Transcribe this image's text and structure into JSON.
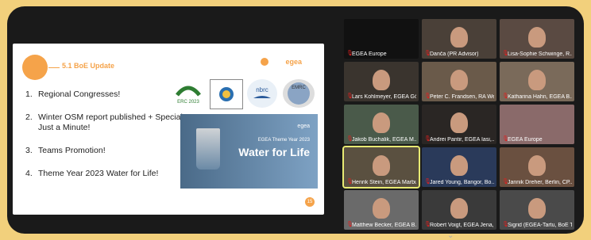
{
  "slide": {
    "title": "5.1 BoE Update",
    "brand": "egea",
    "items": [
      {
        "num": "1.",
        "text": "Regional Congresses!"
      },
      {
        "num": "2.",
        "text": "Winter OSM report published + Special Just a Minute!"
      },
      {
        "num": "3.",
        "text": "Teams Promotion!"
      },
      {
        "num": "4.",
        "text": "Theme Year 2023 Water for Life!"
      }
    ],
    "logos": [
      "ERC 2023",
      "WESTERN REGIONAL CONGRESS 2023",
      "nbrc",
      "EMRC"
    ],
    "banner": {
      "brand": "egea",
      "subtitle": "EGEA Theme Year 2023",
      "title": "Water for Life"
    },
    "page_badge": "15"
  },
  "participants": [
    {
      "name": "EGEA Europe",
      "bg": "#111"
    },
    {
      "name": "Danča (PR Advisor)",
      "bg": "#4a4038"
    },
    {
      "name": "Lisa-Sophie Schwinge, R...",
      "bg": "#5a4a42"
    },
    {
      "name": "Lars Kohlmeyer, EGEA Gö...",
      "bg": "#3a342e"
    },
    {
      "name": "Peter C. Frandsen, RA We...",
      "bg": "#6a5a4a"
    },
    {
      "name": "Katharina Hahn, EGEA B...",
      "bg": "#7a6a5a"
    },
    {
      "name": "Jakob Buchalik, EGEA M...",
      "bg": "#4a5a4a"
    },
    {
      "name": "Andrei Pantir, EGEA Iasi,...",
      "bg": "#2a2624"
    },
    {
      "name": "EGEA Europe",
      "bg": "#8a6a6a"
    },
    {
      "name": "Henrik Stein, EGEA Marburg...",
      "bg": "#5a5040"
    },
    {
      "name": "Jared Young, Bangor, Bo...",
      "bg": "#2a3a5a"
    },
    {
      "name": "Jannik Dreher, Berlin, CP...",
      "bg": "#6a5040"
    },
    {
      "name": "Matthew Becker, EGEA B...",
      "bg": "#6a6a6a"
    },
    {
      "name": "Robert Voigt, EGEA Jena,...",
      "bg": "#3a3a3a"
    },
    {
      "name": "Sigrid (EGEA-Tartu, BoE T...",
      "bg": "#4a4a4a"
    }
  ]
}
